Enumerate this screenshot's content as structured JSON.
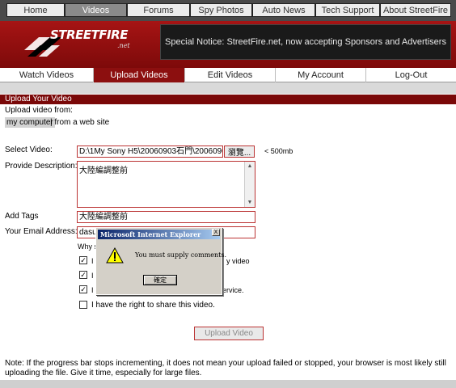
{
  "top_nav": [
    "Home",
    "Videos",
    "Forums",
    "Spy Photos",
    "Auto News",
    "Tech Support",
    "About StreetFire"
  ],
  "top_nav_active": "Videos",
  "brand": {
    "name": "STREETFIRE",
    "suffix": ".net"
  },
  "notice": "Special Notice: StreetFire.net, now accepting Sponsors and Advertisers",
  "sub_nav": [
    "Watch Videos",
    "Upload Videos",
    "Edit Videos",
    "My Account",
    "Log-Out"
  ],
  "sub_nav_active": "Upload Videos",
  "section_title": "Upload Your Video",
  "upload_from_label": "Upload video from:",
  "source_options": {
    "computer": "my computer",
    "web": "| from a web site"
  },
  "select_video_label": "Select Video:",
  "select_video_value": "D:\\1My Sony H5\\20060903石門\\20060903石",
  "browse_label": "瀏覽...",
  "size_limit": "< 500mb",
  "description_label": "Provide Description:",
  "description_value": "大陸編調整前",
  "tags_label": "Add Tags",
  "tags_value": "大陸編調整前",
  "email_label": "Your Email Address:",
  "email_value": "dasu",
  "checklist_header": "Why s",
  "checkboxes": [
    {
      "prefix": "I",
      "suffix": "y video",
      "checked": true
    },
    {
      "prefix": "I",
      "suffix": "",
      "checked": true
    },
    {
      "prefix": "I",
      "suffix": "ervice.",
      "checked": true
    },
    {
      "prefix": "",
      "suffix": "I have the right to share this video.",
      "checked": false
    }
  ],
  "upload_button": "Upload Video",
  "note": "Note: If the progress bar stops incrementing, it does not mean your upload failed or stopped, your browser is most likely still uploading the file. Give it time, especially for large files.",
  "dialog": {
    "title": "Microsoft Internet Explorer",
    "message": "You must supply comments.",
    "ok_label": "確定",
    "close_label": "X"
  },
  "colors": {
    "brand_red": "#8c0f0f",
    "dark_bar": "#4a4a4a",
    "notice_bg": "#1a1a1a"
  }
}
